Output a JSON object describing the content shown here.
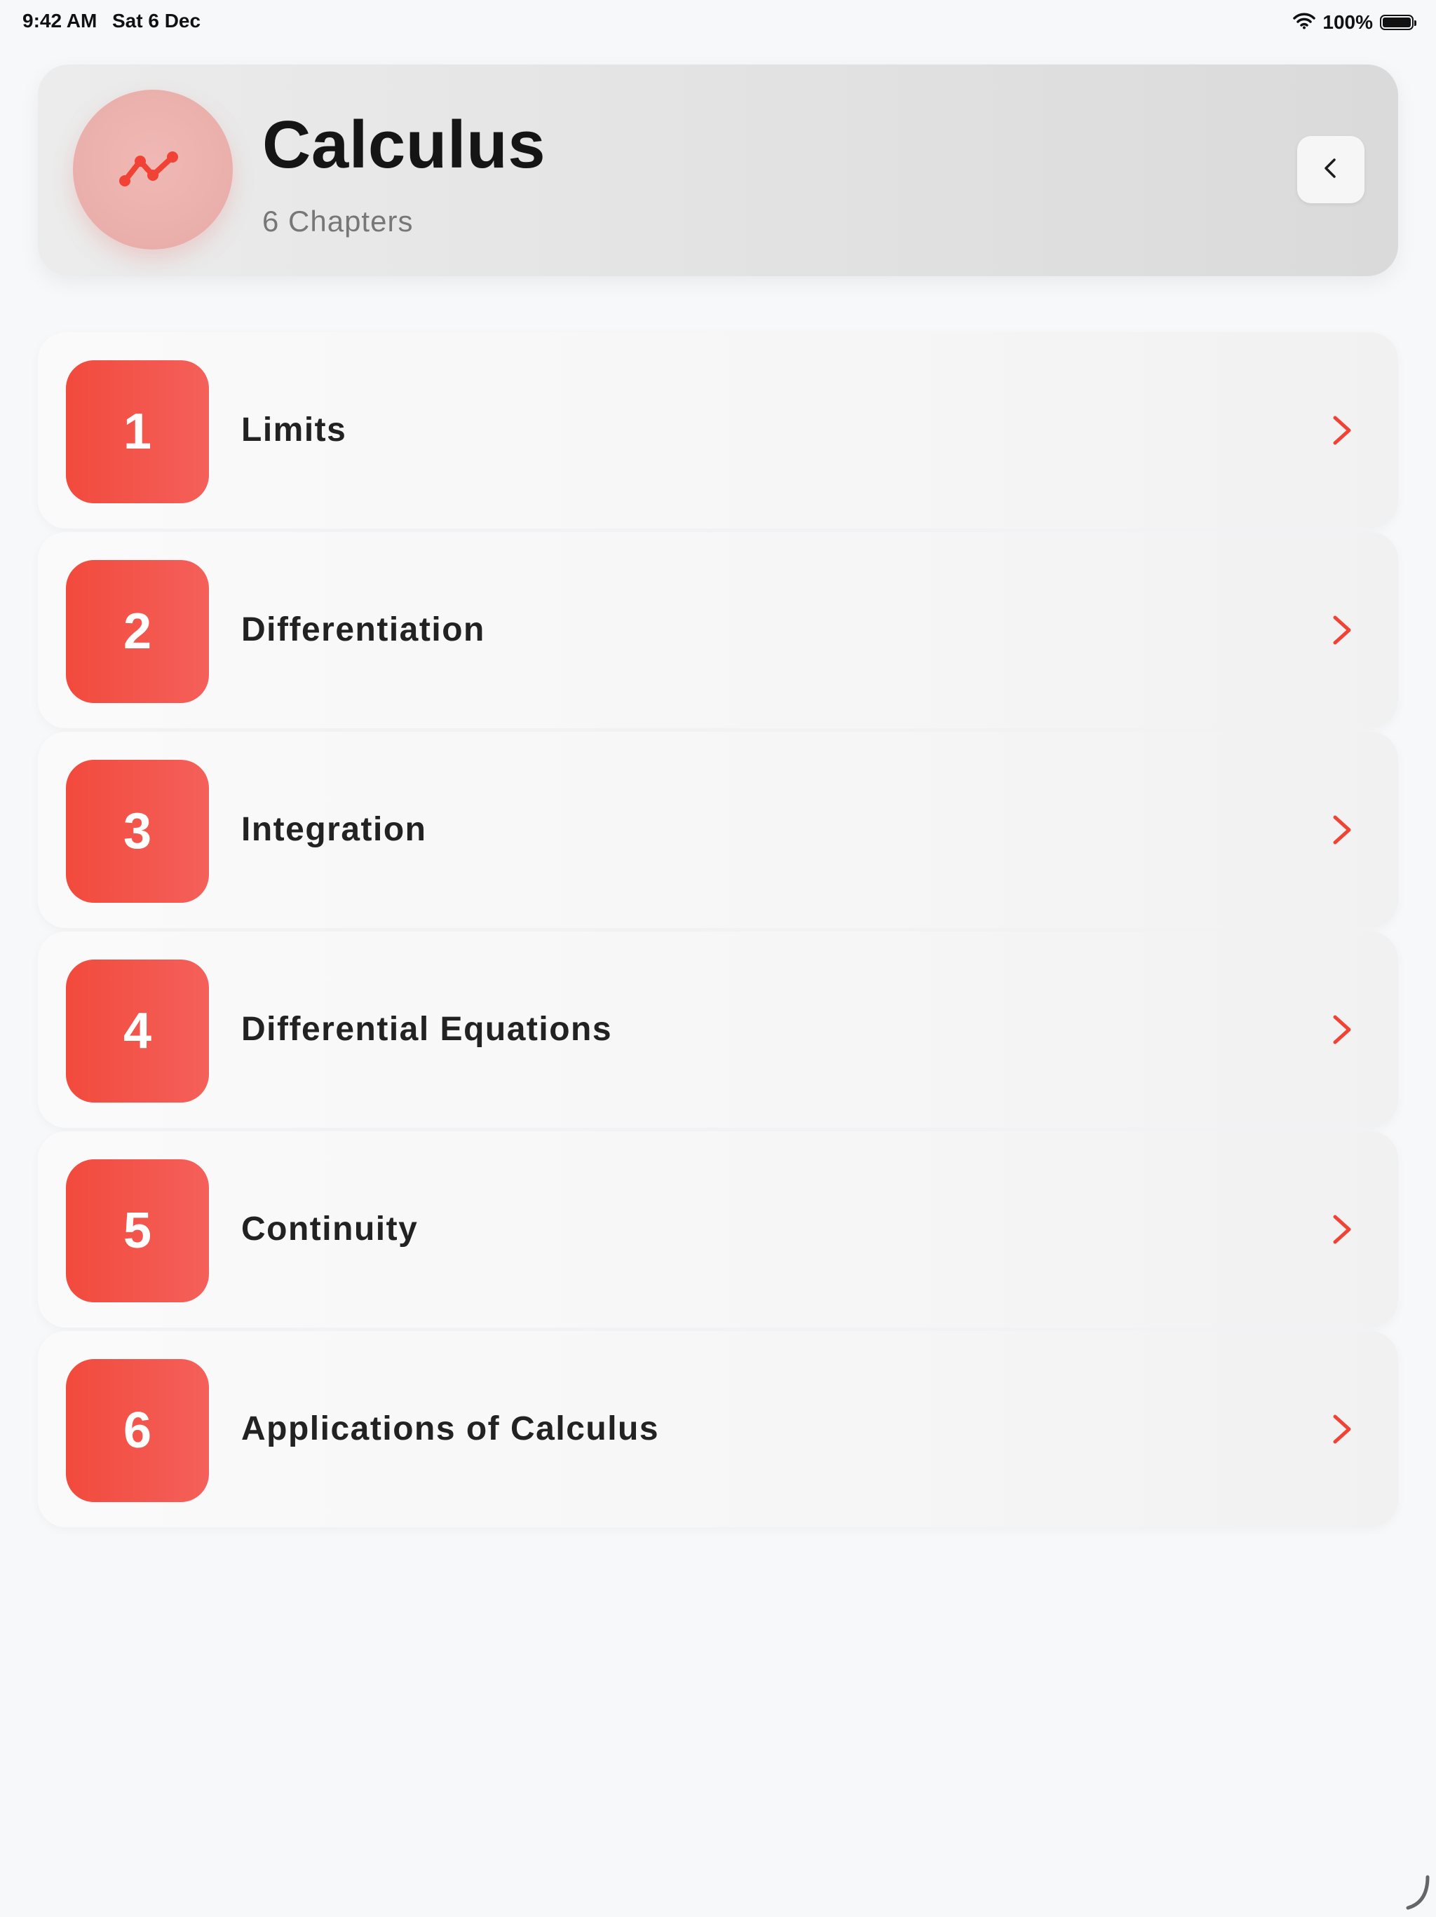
{
  "status_bar": {
    "time": "9:42 AM",
    "date": "Sat 6 Dec",
    "battery_percent": "100%",
    "battery_level": 1.0,
    "wifi_icon": "wifi-icon",
    "battery_icon": "battery-icon"
  },
  "header": {
    "title": "Calculus",
    "subtitle": "6 Chapters",
    "avatar_icon": "line-chart-icon",
    "back_icon": "chevron-left-icon"
  },
  "chapters": [
    {
      "number": "1",
      "title": "Limits"
    },
    {
      "number": "2",
      "title": "Differentiation"
    },
    {
      "number": "3",
      "title": "Integration"
    },
    {
      "number": "4",
      "title": "Differential Equations"
    },
    {
      "number": "5",
      "title": "Continuity"
    },
    {
      "number": "6",
      "title": "Applications of Calculus"
    }
  ],
  "colors": {
    "accent": "#F24A3D",
    "accent_light": "#F4605A",
    "background": "#F7F8FA",
    "avatar_bg": "#EBB1AD"
  }
}
